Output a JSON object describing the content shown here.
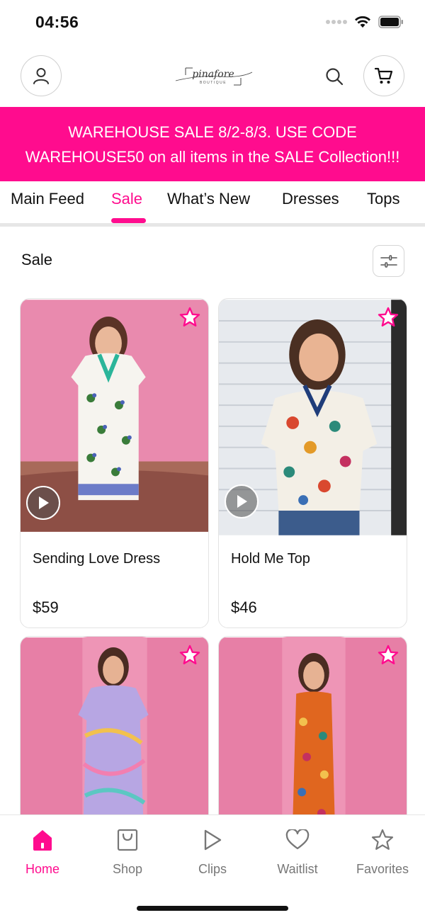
{
  "status_bar": {
    "time": "04:56"
  },
  "header": {
    "logo_script": "pinafore",
    "logo_sub": "BOUTIQUE"
  },
  "banner": {
    "line1": "WAREHOUSE SALE 8/2-8/3. USE CODE",
    "line2": "WAREHOUSE50 on all items in the SALE Collection!!!"
  },
  "tabs": [
    {
      "label": "Main Feed"
    },
    {
      "label": "Sale"
    },
    {
      "label": "What’s New"
    },
    {
      "label": "Dresses"
    },
    {
      "label": "Tops"
    }
  ],
  "section": {
    "title": "Sale"
  },
  "products": [
    {
      "name": "Sending Love Dress",
      "price": "$59"
    },
    {
      "name": "Hold Me Top",
      "price": "$46"
    },
    {
      "name": "",
      "price": ""
    },
    {
      "name": "",
      "price": ""
    }
  ],
  "tabbar": {
    "items": [
      {
        "label": "Home"
      },
      {
        "label": "Shop"
      },
      {
        "label": "Clips"
      },
      {
        "label": "Waitlist"
      },
      {
        "label": "Favorites"
      }
    ]
  },
  "colors": {
    "accent": "#ff0c8e",
    "backdrop_pink": "#e77fa6"
  },
  "icons": [
    "profile-icon",
    "search-icon",
    "cart-icon",
    "filter-icon",
    "star-icon",
    "play-icon",
    "home-icon",
    "shop-bag-icon",
    "play-outline-icon",
    "heart-icon",
    "star-outline-icon"
  ]
}
